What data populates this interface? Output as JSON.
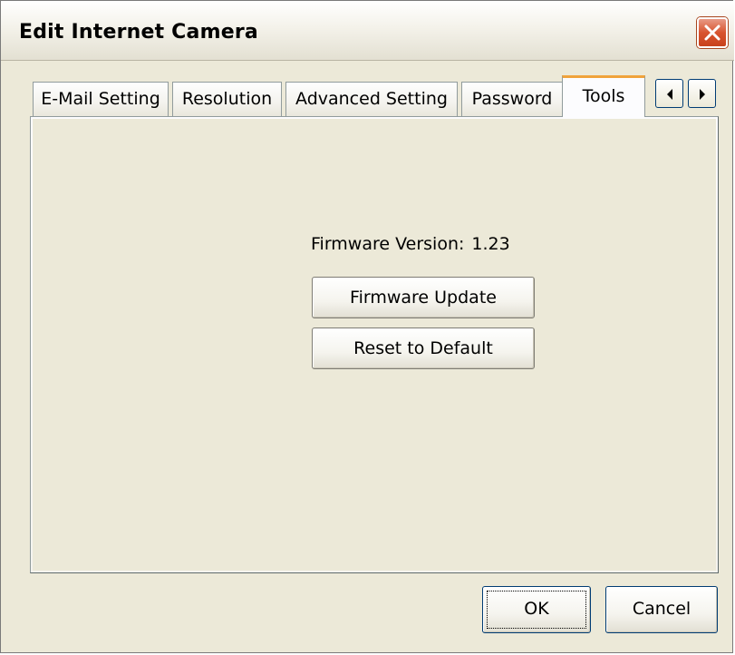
{
  "window": {
    "title": "Edit Internet Camera"
  },
  "tabs": [
    {
      "label": "E-Mail Setting",
      "active": false
    },
    {
      "label": "Resolution",
      "active": false
    },
    {
      "label": "Advanced Setting",
      "active": false
    },
    {
      "label": "Password",
      "active": false
    },
    {
      "label": "Tools",
      "active": true
    }
  ],
  "tools_panel": {
    "firmware_label": "Firmware Version:",
    "firmware_value": "1.23",
    "firmware_update_button": "Firmware Update",
    "reset_button": "Reset to Default"
  },
  "footer": {
    "ok_label": "OK",
    "cancel_label": "Cancel"
  },
  "icons": {
    "close": "close-icon",
    "tab_scroll_left": "arrow-left-icon",
    "tab_scroll_right": "arrow-right-icon"
  },
  "colors": {
    "dialog_bg": "#ece9d8",
    "active_tab_accent": "#f0a33b",
    "close_button": "#d8542f",
    "button_border": "#003c74"
  }
}
